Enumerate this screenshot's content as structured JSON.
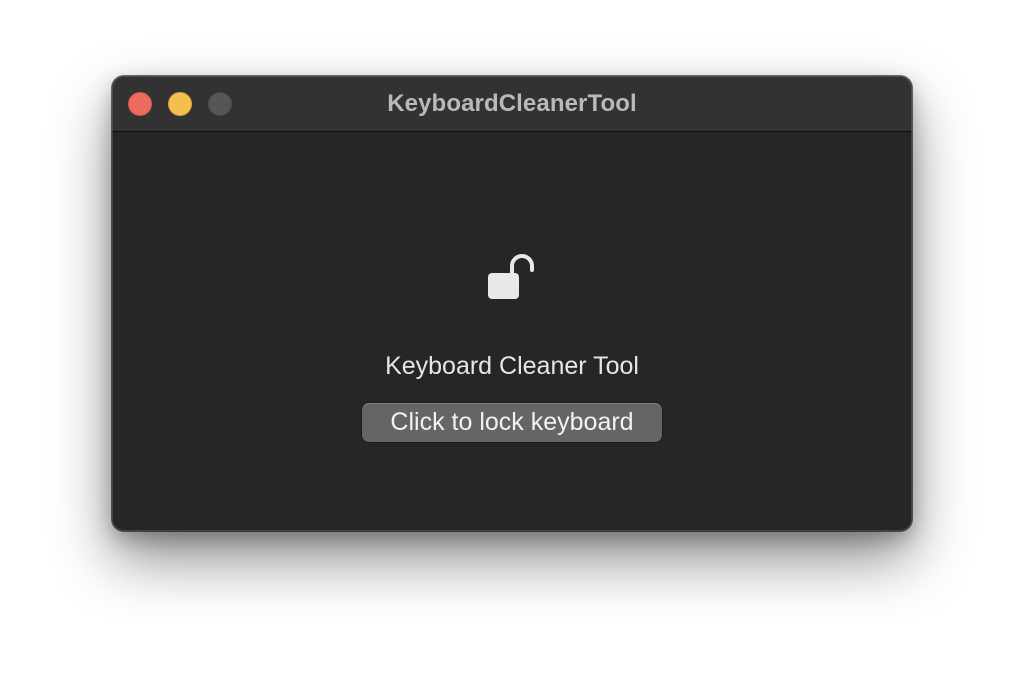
{
  "window": {
    "title": "KeyboardCleanerTool",
    "controls": {
      "close_color": "#ed6a5e",
      "minimize_color": "#f5bf4f",
      "zoom_color": "#565656"
    }
  },
  "main": {
    "icon": "lock-open-icon",
    "app_label": "Keyboard Cleaner Tool",
    "lock_button_label": "Click to lock keyboard"
  },
  "colors": {
    "window_background": "#262626",
    "titlebar_background": "#323232",
    "button_background": "#656565",
    "text": "#e6e6e6"
  }
}
